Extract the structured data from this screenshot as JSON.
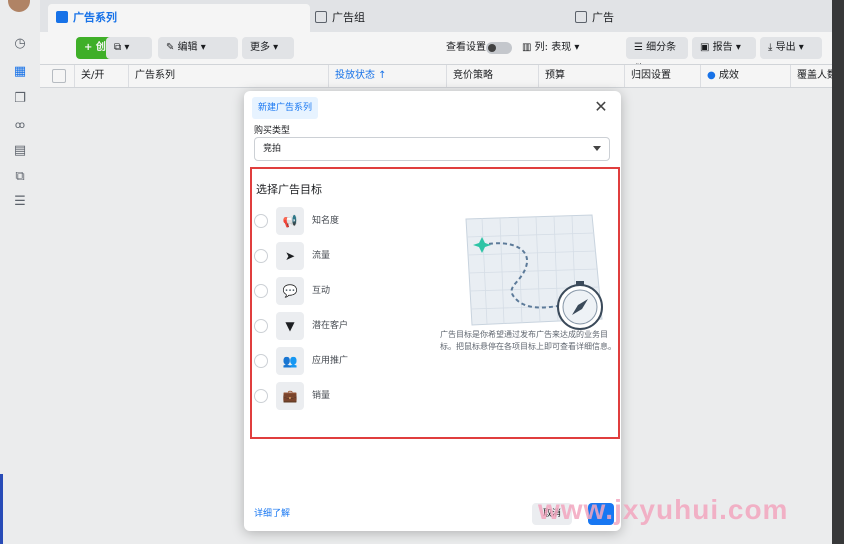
{
  "tabs": {
    "campaign": "广告系列",
    "adset": "广告组",
    "ad": "广告"
  },
  "toolbar": {
    "create": "+ 创建",
    "duplicate": "",
    "edit": "编辑",
    "more": "更多",
    "view_setting": "查看设置",
    "columns": "列: 表现",
    "breakdown": "细分条件",
    "reports": "报告",
    "export": "导出"
  },
  "table": {
    "headers": [
      "关/开",
      "广告系列",
      "投放状态 ↑",
      "竞价策略",
      "预算",
      "归因设置",
      "成效",
      "覆盖人数"
    ]
  },
  "modal": {
    "tab": "新建广告系列",
    "buying_type_label": "购买类型",
    "buying_type_value": "竞拍",
    "objective_title": "选择广告目标",
    "objectives": [
      {
        "label": "知名度",
        "icon": "megaphone-icon"
      },
      {
        "label": "流量",
        "icon": "cursor-icon"
      },
      {
        "label": "互动",
        "icon": "chat-bubbles-icon"
      },
      {
        "label": "潜在客户",
        "icon": "funnel-icon"
      },
      {
        "label": "应用推广",
        "icon": "people-icon"
      },
      {
        "label": "销量",
        "icon": "briefcase-icon"
      }
    ],
    "description": "广告目标是你希望通过发布广告来达成的业务目标。把鼠标悬停在各项目标上即可查看详细信息。",
    "learn_more": "详细了解",
    "cancel": "取消"
  },
  "watermark": "www.jxyuhui.com",
  "colors": {
    "accent": "#1877f2",
    "create": "#42b72a",
    "highlight_border": "#e03e3e"
  }
}
